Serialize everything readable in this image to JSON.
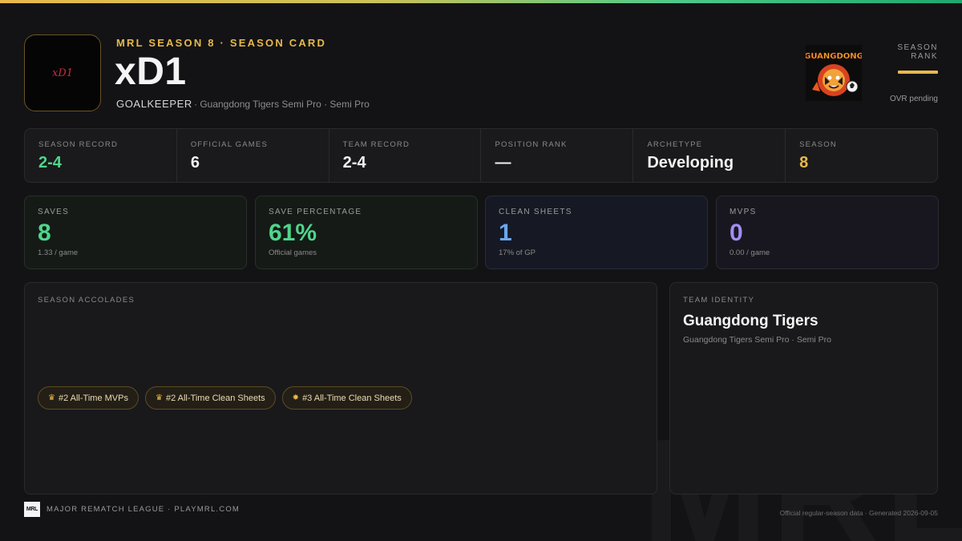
{
  "colors": {
    "accent_gold": "#e8b94a",
    "green": "#4fd68a",
    "blue": "#6aa6f0",
    "purple": "#a48cf2",
    "background": "#131315"
  },
  "header": {
    "logo_text": "xD1",
    "eyebrow": "MRL SEASON 8 · SEASON CARD",
    "player_name": "xD1",
    "position": "GOALKEEPER",
    "team_line": "· Guangdong Tigers Semi Pro · Semi Pro",
    "team_badge_text": "GUANGDONG",
    "team_badge_icon": "tiger-mascot-icon",
    "rank_label": "SEASON RANK",
    "rank_status": "OVR pending"
  },
  "strip": [
    {
      "label": "SEASON RECORD",
      "value": "2-4",
      "color": "#4fd68a"
    },
    {
      "label": "OFFICIAL GAMES",
      "value": "6",
      "color": "#f2f2f2"
    },
    {
      "label": "TEAM RECORD",
      "value": "2-4",
      "color": "#f2f2f2"
    },
    {
      "label": "POSITION RANK",
      "value": "—",
      "color": "#f2f2f2"
    },
    {
      "label": "ARCHETYPE",
      "value": "Developing",
      "color": "#f2f2f2"
    },
    {
      "label": "SEASON",
      "value": "8",
      "color": "#e8b94a"
    }
  ],
  "cards": {
    "saves": {
      "label": "SAVES",
      "value": "8",
      "sub": "1.33 / game"
    },
    "save_pct": {
      "label": "SAVE PERCENTAGE",
      "value": "61%",
      "sub": "Official games"
    },
    "clean_sheets": {
      "label": "CLEAN SHEETS",
      "value": "1",
      "sub": "17% of GP"
    },
    "mvps": {
      "label": "MVPS",
      "value": "0",
      "sub": "0.00 / game"
    }
  },
  "accolades": {
    "label": "SEASON ACCOLADES",
    "items": [
      {
        "icon": "crown-icon",
        "glyph": "♛",
        "text": "#2 All-Time MVPs"
      },
      {
        "icon": "crown-icon",
        "glyph": "♛",
        "text": "#2 All-Time Clean Sheets"
      },
      {
        "icon": "star-badge-icon",
        "glyph": "✸",
        "text": "#3 All-Time Clean Sheets"
      }
    ]
  },
  "team_identity": {
    "label": "TEAM IDENTITY",
    "name": "Guangdong Tigers",
    "sub": "Guangdong Tigers Semi Pro · Semi Pro"
  },
  "footer": {
    "logo_text": "MRL",
    "brand": "MAJOR REMATCH LEAGUE · PLAYMRL.COM",
    "note": "Official regular-season data · Generated 2026-09-05",
    "watermark": "MRL"
  }
}
